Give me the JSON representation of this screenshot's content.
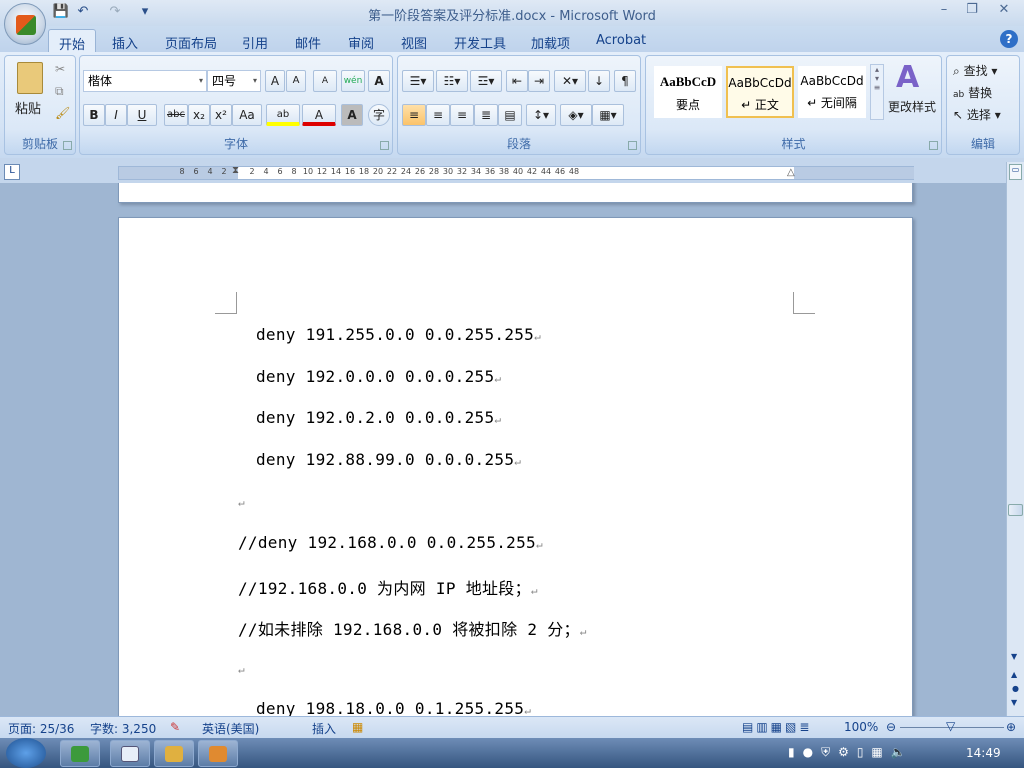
{
  "window": {
    "title": "第一阶段答案及评分标准.docx - Microsoft Word",
    "minimize": "–",
    "restore": "❐",
    "close": "✕"
  },
  "qat": {
    "save": "💾",
    "undo": "↶",
    "redo": "↷",
    "customize": "▾"
  },
  "tabs": [
    "开始",
    "插入",
    "页面布局",
    "引用",
    "邮件",
    "审阅",
    "视图",
    "开发工具",
    "加载项",
    "Acrobat"
  ],
  "help": "?",
  "clipboard": {
    "paste": "粘贴",
    "label": "剪贴板"
  },
  "font": {
    "name": "楷体",
    "size": "四号",
    "label": "字体",
    "grow": "A",
    "shrink": "A",
    "clear": "A",
    "phonetic": "wén",
    "border": "A",
    "bold": "B",
    "italic": "I",
    "underline": "U",
    "strike": "abc",
    "sub": "x₂",
    "sup": "x²",
    "case": "Aa",
    "highlight": "ab",
    "color": "A",
    "shade": "A",
    "enclose": "字"
  },
  "paragraph": {
    "label": "段落"
  },
  "styles": {
    "label": "样式",
    "items": [
      {
        "sample": "AaBbCcD",
        "name": "要点"
      },
      {
        "sample": "AaBbCcDd",
        "name": "↵ 正文"
      },
      {
        "sample": "AaBbCcDd",
        "name": "↵ 无间隔"
      }
    ],
    "change": "更改样式"
  },
  "editing": {
    "label": "编辑",
    "find": "查找",
    "replace": "替换",
    "select": "选择"
  },
  "ruler": {
    "left": [
      "8",
      "6",
      "4",
      "2"
    ],
    "right": [
      "2",
      "4",
      "6",
      "8",
      "10",
      "12",
      "14",
      "16",
      "18",
      "20",
      "22",
      "24",
      "26",
      "28",
      "30",
      "32",
      "34",
      "36",
      "38",
      "40",
      "42",
      "44",
      "46",
      "48"
    ]
  },
  "document": {
    "lines": [
      {
        "text": "deny 191.255.0.0 0.0.255.255",
        "indent": true
      },
      {
        "text": "deny 192.0.0.0 0.0.0.255",
        "indent": true
      },
      {
        "text": "deny 192.0.2.0 0.0.0.255",
        "indent": true
      },
      {
        "text": "deny 192.88.99.0 0.0.0.255",
        "indent": true
      },
      {
        "text": "",
        "indent": false
      },
      {
        "text": "//deny 192.168.0.0 0.0.255.255",
        "indent": false
      },
      {
        "text": "//192.168.0.0 为内网 IP 地址段；",
        "indent": false
      },
      {
        "text": "//如未排除 192.168.0.0 将被扣除 2 分；",
        "indent": false
      },
      {
        "text": "",
        "indent": false
      },
      {
        "text": "deny 198.18.0.0 0.1.255.255",
        "indent": true
      }
    ],
    "para_mark": "↵"
  },
  "status": {
    "page": "页面: 25/36",
    "words": "字数: 3,250",
    "language": "英语(美国)",
    "mode": "插入",
    "zoom": "100%"
  },
  "taskbar": {
    "clock": "14:49"
  }
}
